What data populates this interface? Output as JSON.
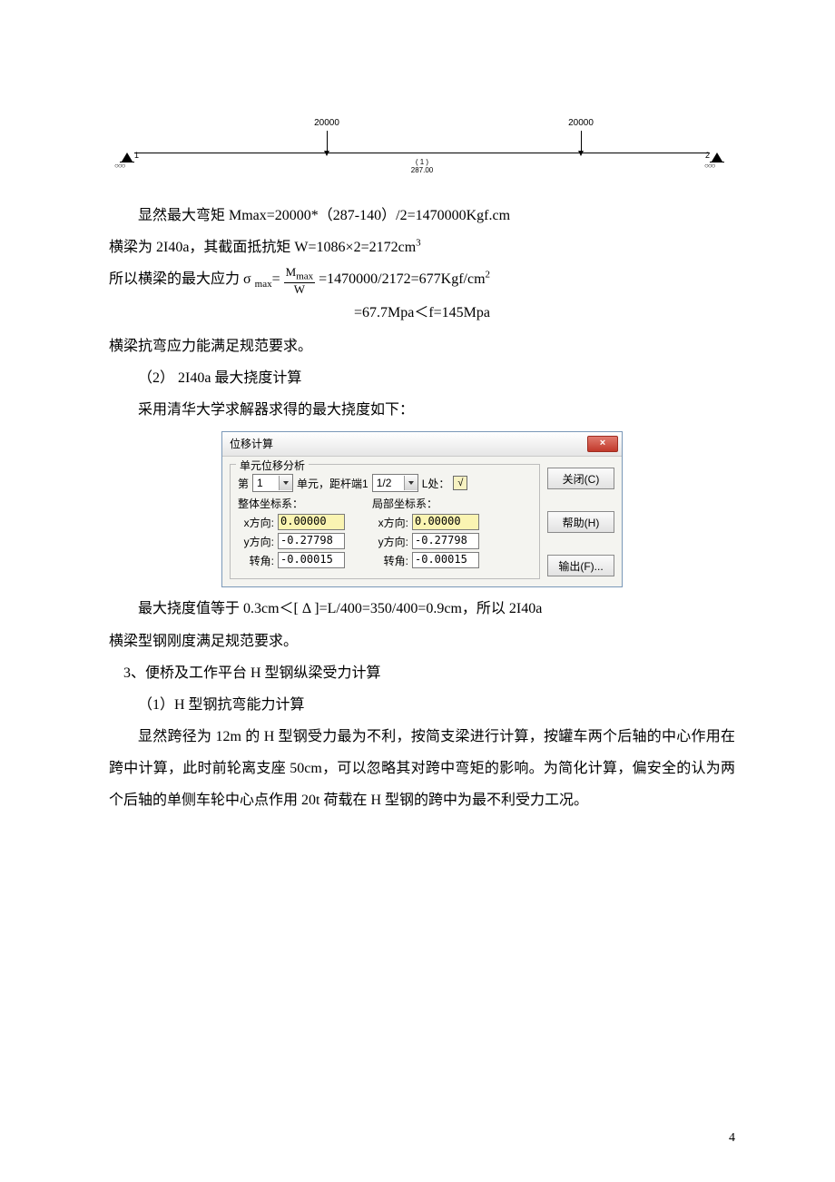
{
  "beam": {
    "loads": [
      "20000",
      "20000"
    ],
    "mid_label1": "( 1 )",
    "mid_label2": "287.00",
    "support_left_id": "1",
    "support_right_id": "2"
  },
  "p1": "显然最大弯矩 Mmax=20000*（287-140）/2=1470000Kgf.cm",
  "p2a": "横梁为 2I40a，其截面抵抗矩 W=1086×2=2172cm",
  "p2sup": "3",
  "p3a": "所以横梁的最大应力 σ ",
  "p3sub": "max",
  "p3eq": "=",
  "frac": {
    "num": "M",
    "numsub": "max",
    "den": "W"
  },
  "p3b": "=1470000/2172=677Kgf/cm",
  "p3sup": "2",
  "p4": "=67.7Mpa＜f=145Mpa",
  "p5": "横梁抗弯应力能满足规范要求。",
  "p6": "（2）  2I40a 最大挠度计算",
  "p7": "采用清华大学求解器求得的最大挠度如下：",
  "dialog": {
    "title": "位移计算",
    "close_text": "×",
    "group_title": "单元位移分析",
    "row1": {
      "pre": "第",
      "dd1": "1",
      "mid": "单元，距杆端1",
      "dd2": "1/2",
      "post": "L处：",
      "checked": "√"
    },
    "cols": {
      "left_title": "整体坐标系：",
      "right_title": "局部坐标系：",
      "xlabel": "x方向:",
      "ylabel": "y方向:",
      "alabel": "转角:",
      "gx": "0.00000",
      "gy": "-0.27798",
      "ga": "-0.00015",
      "lx": "0.00000",
      "ly": "-0.27798",
      "la": "-0.00015"
    },
    "btn_close": "关闭(C)",
    "btn_help": "帮助(H)",
    "btn_out": "输出(F)..."
  },
  "p8": "最大挠度值等于 0.3cm＜[ Δ ]=L/400=350/400=0.9cm，所以 2I40a",
  "p9": "横梁型钢刚度满足规范要求。",
  "h3": "3、便桥及工作平台 H 型钢纵梁受力计算",
  "h3a": "（1）H 型钢抗弯能力计算",
  "p10": "显然跨径为 12m 的 H 型钢受力最为不利，按简支梁进行计算，按罐车两个后轴的中心作用在跨中计算，此时前轮离支座 50cm，可以忽略其对跨中弯矩的影响。为简化计算，偏安全的认为两个后轴的单侧车轮中心点作用 20t 荷载在 H 型钢的跨中为最不利受力工况。",
  "page_number": "4"
}
